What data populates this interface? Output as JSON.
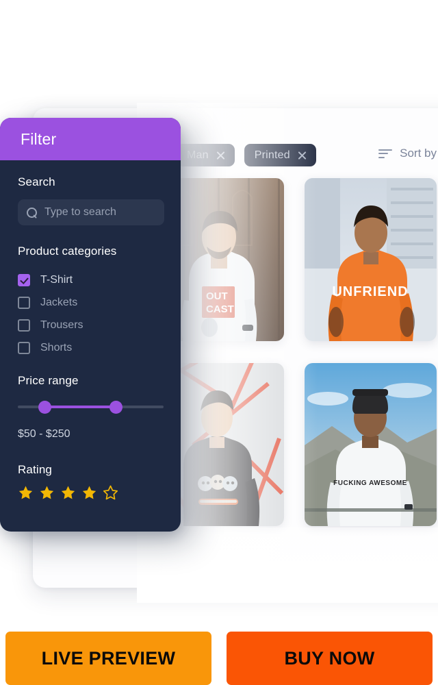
{
  "panel": {
    "title": "Filter",
    "search": {
      "label": "Search",
      "placeholder": "Type to search",
      "value": "",
      "icon": "search-icon"
    },
    "categories": {
      "label": "Product categories",
      "items": [
        {
          "label": "T-Shirt",
          "checked": true
        },
        {
          "label": "Jackets",
          "checked": false
        },
        {
          "label": "Trousers",
          "checked": false
        },
        {
          "label": "Shorts",
          "checked": false
        }
      ]
    },
    "price": {
      "label": "Price range",
      "value_text": "$50 - $250",
      "min": 50,
      "max": 250
    },
    "rating": {
      "label": "Rating",
      "value": 4,
      "total": 5
    },
    "colors": {
      "header": "#9b51e0",
      "body": "#1e2942",
      "accent": "#a462ee",
      "star": "#f2b705"
    }
  },
  "toolbar": {
    "chips": [
      {
        "label": "Man",
        "remove_icon": "close-icon"
      },
      {
        "label": "Printed",
        "remove_icon": "close-icon"
      }
    ],
    "sort": {
      "label": "Sort by",
      "icon": "sort-icon"
    }
  },
  "products": [
    {
      "alt": "man in white OUTCAST print t-shirt in front of wooden door"
    },
    {
      "alt": "man in orange UNFRIEND varsity t-shirt on city street"
    },
    {
      "alt": "person in black graphic t-shirt at red playground"
    },
    {
      "alt": "man in white printed t-shirt with beanie in mountains"
    }
  ],
  "footer": {
    "live_preview_label": "LIVE PREVIEW",
    "buy_now_label": "BUY NOW",
    "live_preview_color": "#f9960a",
    "buy_now_color": "#fa5505"
  }
}
